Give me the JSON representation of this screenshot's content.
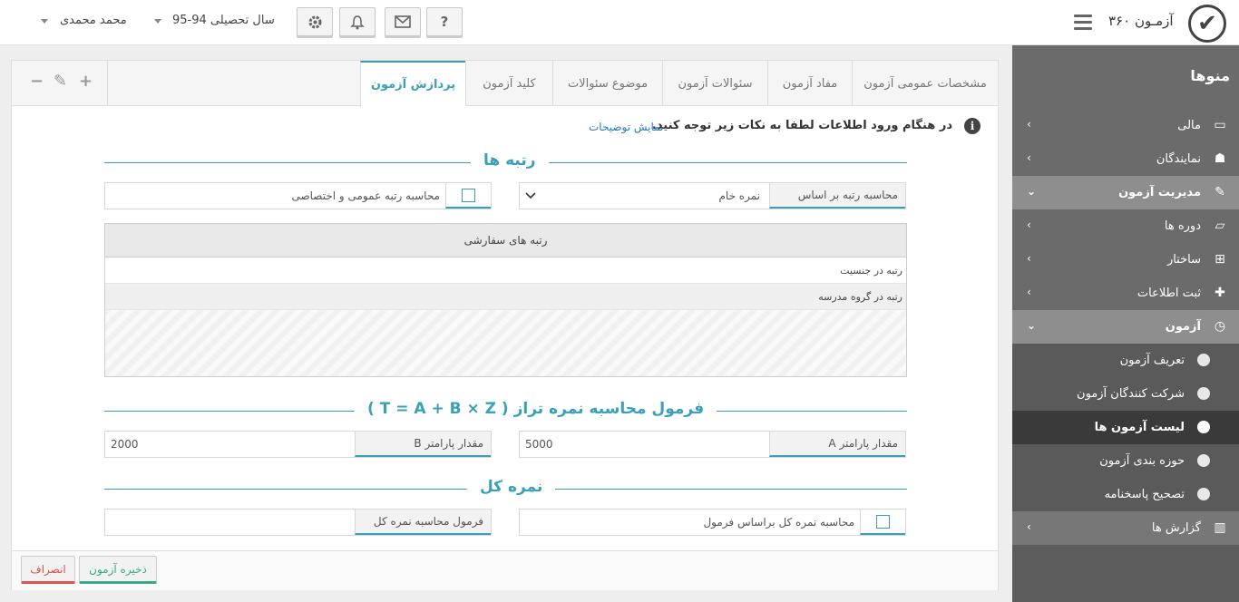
{
  "app": {
    "title": "آزمـون ۳۶۰",
    "logo_mark": "✔"
  },
  "topbar": {
    "help_label": "?",
    "year_label": "سال تحصیلی 94-95",
    "user_name": "محمد محمدی"
  },
  "sidebar": {
    "header": "منوها",
    "items": [
      {
        "label": "مالی",
        "icon": "credit-card-icon"
      },
      {
        "label": "نمایندگان",
        "icon": "agent-icon"
      },
      {
        "label": "مدیریت آزمون",
        "icon": "edit-icon"
      },
      {
        "label": "دوره ها",
        "icon": "folder-icon"
      },
      {
        "label": "ساختار",
        "icon": "sitemap-icon"
      },
      {
        "label": "ثبت اطلاعات",
        "icon": "user-plus-icon"
      },
      {
        "label": "آزمون",
        "icon": "clock-icon"
      },
      {
        "label": "تعریف آزمون"
      },
      {
        "label": "شرکت کنندگان آزمون"
      },
      {
        "label": "لیست آزمون ها"
      },
      {
        "label": "حوزه بندی آزمون"
      },
      {
        "label": "تصحیح پاسخنامه"
      },
      {
        "label": "گزارش ها",
        "icon": "bar-chart-icon"
      }
    ]
  },
  "tabs": [
    {
      "label": "مشخصات عمومی آزمون"
    },
    {
      "label": "مفاد آزمون"
    },
    {
      "label": "سئوالات آزمون"
    },
    {
      "label": "موضوع سئوالات"
    },
    {
      "label": "کلید آزمون"
    },
    {
      "label": "پردازش آزمون"
    }
  ],
  "panel_tools": {
    "minus": "−",
    "edit": "✎",
    "plus": "+"
  },
  "notice": {
    "text": "در هنگام ورود اطلاعات لطفا به نکات زیر توجه کنید.",
    "link": "نمایش توضیحات"
  },
  "ranks": {
    "title": "رتبه ها",
    "basis_label": "محاسبه رتبه بر اساس",
    "basis_value": "نمره خام",
    "general_special_label": "محاسبه رتبه عمومی و اختصاصی",
    "table_header": "رتبه های سفارشی",
    "rows": [
      "رتبه در جنسیت",
      "رتبه در گروه مدرسه"
    ]
  },
  "formula": {
    "title": "فرمول محاسبه نمره تراز ( T = A + B × Z )",
    "param_a_label": "مقدار پارامتر A",
    "param_a_value": "5000",
    "param_b_label": "مقدار پارامتر B",
    "param_b_value": "2000"
  },
  "total": {
    "title": "نمره کل",
    "by_formula_label": "محاسبه نمره کل براساس فرمول",
    "formula_label": "فرمول محاسبه نمره کل"
  },
  "footer": {
    "save": "ذخیره آزمون",
    "cancel": "انصراف"
  },
  "colors": {
    "accent": "#3aa0b8",
    "save": "#39a98a",
    "cancel": "#d9534f",
    "sidebar": "#5d5d5d"
  }
}
